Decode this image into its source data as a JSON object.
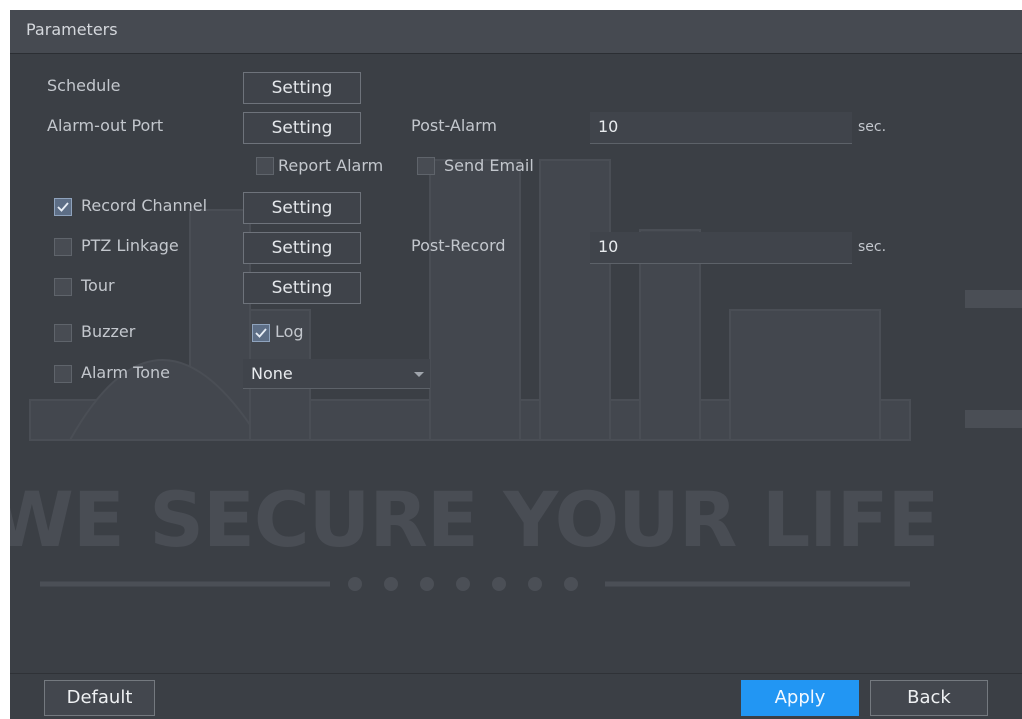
{
  "panel": {
    "title": "Parameters"
  },
  "watermark": {
    "text": "WE SECURE YOUR LIFE"
  },
  "schedule": {
    "label": "Schedule",
    "button": "Setting"
  },
  "alarm_out": {
    "label": "Alarm-out Port",
    "button": "Setting",
    "post_label": "Post-Alarm",
    "post_value": "10",
    "unit": "sec."
  },
  "report_alarm": {
    "label": "Report Alarm",
    "checked": false
  },
  "send_email": {
    "label": "Send Email",
    "checked": false
  },
  "record_channel": {
    "label": "Record Channel",
    "checked": true,
    "button": "Setting"
  },
  "ptz": {
    "label": "PTZ Linkage",
    "checked": false,
    "button": "Setting",
    "post_label": "Post-Record",
    "post_value": "10",
    "unit": "sec."
  },
  "tour": {
    "label": "Tour",
    "checked": false,
    "button": "Setting"
  },
  "buzzer": {
    "label": "Buzzer",
    "checked": false
  },
  "log": {
    "label": "Log",
    "checked": true
  },
  "alarm_tone": {
    "label": "Alarm Tone",
    "checked": false,
    "value": "None"
  },
  "footer": {
    "default": "Default",
    "apply": "Apply",
    "back": "Back"
  },
  "colors": {
    "accent": "#2296f3",
    "panel_bg": "#3b3f45",
    "button_border": "#6e737b"
  }
}
